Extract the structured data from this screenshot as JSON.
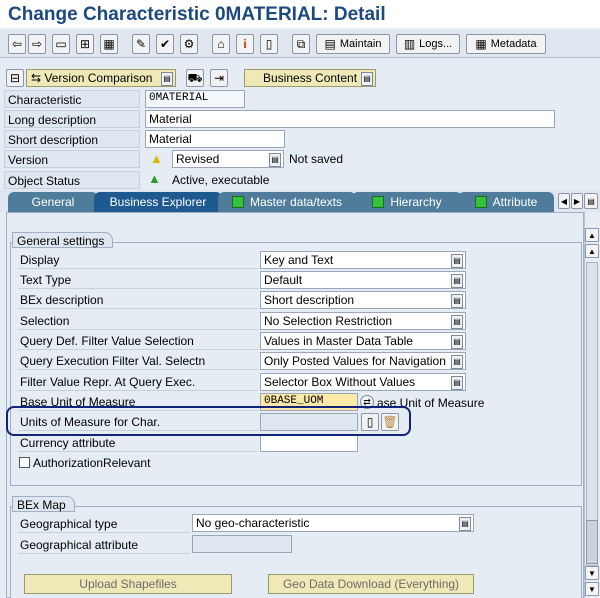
{
  "title": "Change Characteristic 0MATERIAL: Detail",
  "toolbar": {
    "maintain_label": "Maintain",
    "logs_label": "Logs...",
    "metadata_label": "Metadata"
  },
  "subbar": {
    "version_comparison_label": "Version Comparison",
    "business_content_label": "Business Content"
  },
  "header": {
    "characteristic_label": "Characteristic",
    "characteristic_value": "0MATERIAL",
    "long_desc_label": "Long description",
    "long_desc_value": "Material",
    "short_desc_label": "Short description",
    "short_desc_value": "Material",
    "version_label": "Version",
    "version_value": "Revised",
    "version_status": "Not saved",
    "object_status_label": "Object Status",
    "object_status_value": "Active, executable"
  },
  "tabs": [
    {
      "label": "General"
    },
    {
      "label": "Business Explorer"
    },
    {
      "label": "Master data/texts"
    },
    {
      "label": "Hierarchy"
    },
    {
      "label": "Attribute"
    }
  ],
  "general_settings": {
    "title": "General settings",
    "rows": [
      {
        "label": "Display",
        "value": "Key and Text"
      },
      {
        "label": "Text Type",
        "value": "Default"
      },
      {
        "label": "BEx description",
        "value": "Short description"
      },
      {
        "label": "Selection",
        "value": "No Selection Restriction"
      },
      {
        "label": "Query Def. Filter Value Selection",
        "value": "Values in Master Data Table"
      },
      {
        "label": "Query Execution Filter Val. Selectn",
        "value": "Only Posted Values for Navigation"
      },
      {
        "label": "Filter Value Repr. At Query Exec.",
        "value": "Selector Box Without Values"
      }
    ],
    "base_uom_label": "Base Unit of Measure",
    "base_uom_value": "0BASE_UOM",
    "base_uom_desc": "ase Unit of Measure",
    "uom_char_label": "Units of Measure for Char.",
    "currency_label": "Currency attribute",
    "auth_label": "AuthorizationRelevant"
  },
  "bex_map": {
    "title": "BEx Map",
    "geo_type_label": "Geographical type",
    "geo_type_value": "No geo-characteristic",
    "geo_attr_label": "Geographical attribute",
    "upload_label": "Upload Shapefiles",
    "download_label": "Geo Data Download (Everything)"
  },
  "colors": {
    "title": "#1d4a7e",
    "tab_active": "#1e5a8f",
    "tab": "#4f7c9a",
    "highlight": "#12237a"
  }
}
